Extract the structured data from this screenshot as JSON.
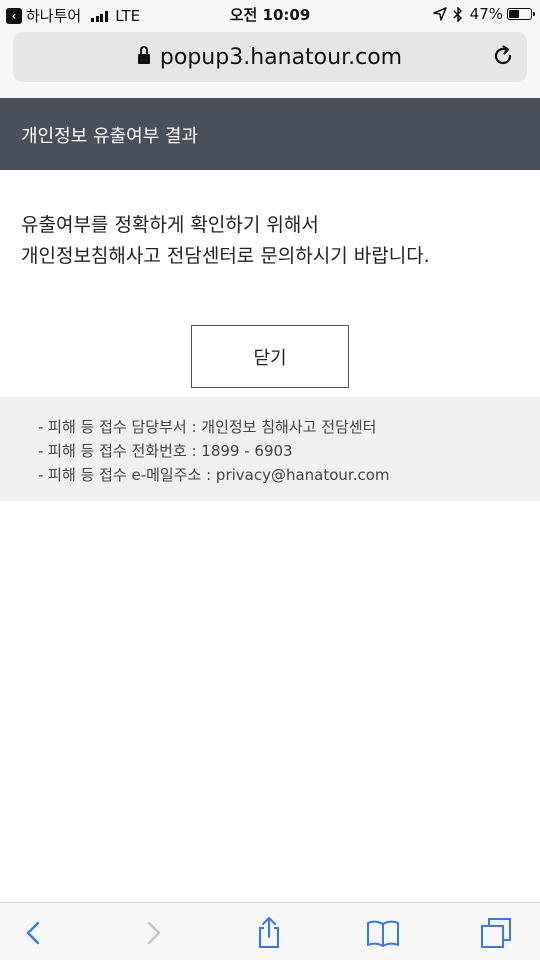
{
  "status_bar": {
    "back_app": "하나투어",
    "carrier": "LTE",
    "time": "오전 10:09",
    "battery": "47%"
  },
  "browser": {
    "url": "popup3.hanatour.com"
  },
  "header": {
    "title": "개인정보 유출여부 결과"
  },
  "message": {
    "line1": "유출여부를 정확하게 확인하기 위해서",
    "line2": "개인정보침해사고 전담센터로 문의하시기 바랍니다."
  },
  "close_button": {
    "label": "닫기"
  },
  "info": {
    "lines": [
      "- 피해 등 접수 담당부서 : 개인정보 침해사고 전담센터",
      "- 피해 등 접수 전화번호 : 1899 - 6903",
      "- 피해 등 접수 e-메일주소 : privacy@hanatour.com"
    ]
  },
  "colors": {
    "header_bg": "#4a4f5c",
    "info_bg": "#eef0f2",
    "toolbar_accent": "#3478f6"
  }
}
